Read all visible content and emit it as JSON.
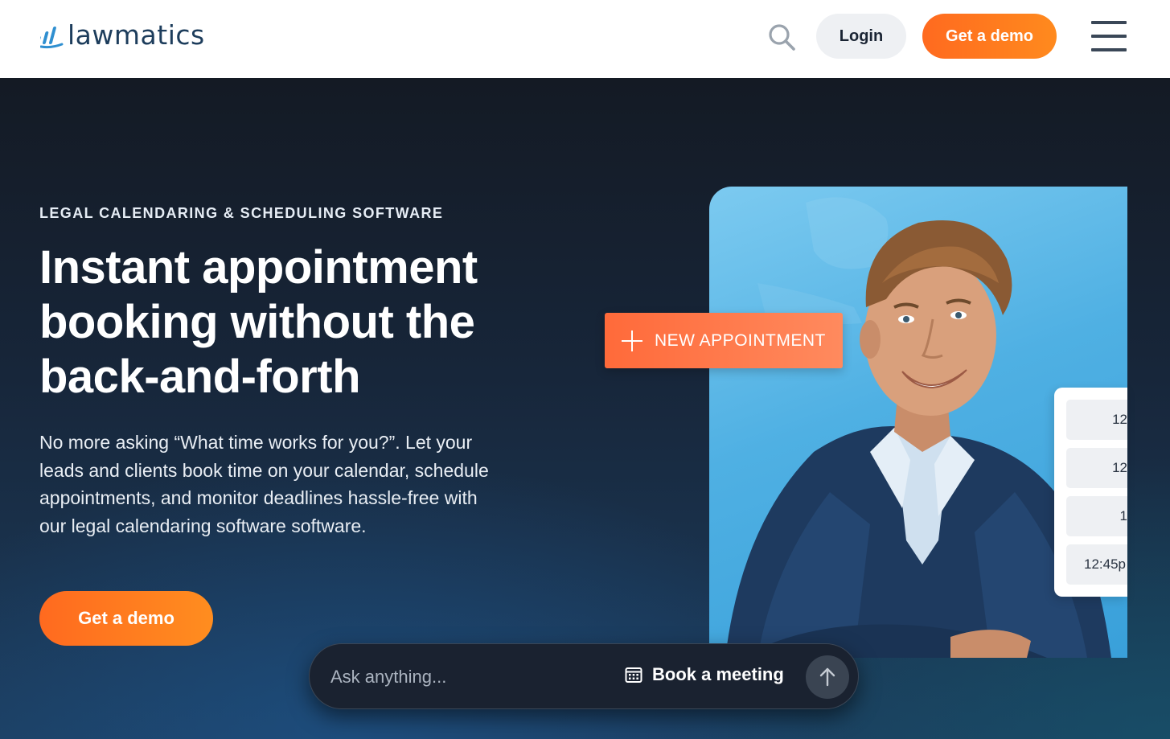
{
  "header": {
    "logo_text": "lawmatics",
    "login_label": "Login",
    "demo_label": "Get a demo",
    "icons": {
      "search": "search-icon",
      "menu": "hamburger-menu-icon",
      "logo": "lawmatics-logo-icon"
    }
  },
  "hero": {
    "eyebrow": "LEGAL CALENDARING & SCHEDULING SOFTWARE",
    "headline": "Instant appointment booking without the back-and-forth",
    "subtext": "No more asking “What time works for you?”. Let your leads and clients book time on your calendar, schedule appointments, and monitor deadlines hassle-free with our legal calendaring software software.",
    "cta_label": "Get a demo"
  },
  "visual": {
    "new_appointment_label": "NEW APPOINTMENT",
    "time_slots": [
      "12",
      "12",
      "1",
      "12:45p"
    ]
  },
  "chat": {
    "placeholder": "Ask anything...",
    "book_meeting_label": "Book a meeting",
    "icons": {
      "calendar": "calendar-icon",
      "send": "arrow-up-icon"
    }
  },
  "colors": {
    "accent_orange": "#ff7a1f",
    "header_bg": "#ffffff",
    "hero_bg_dark": "#141a24",
    "logo_blue": "#1d3d5c",
    "photo_blue": "#4fb0e3"
  }
}
